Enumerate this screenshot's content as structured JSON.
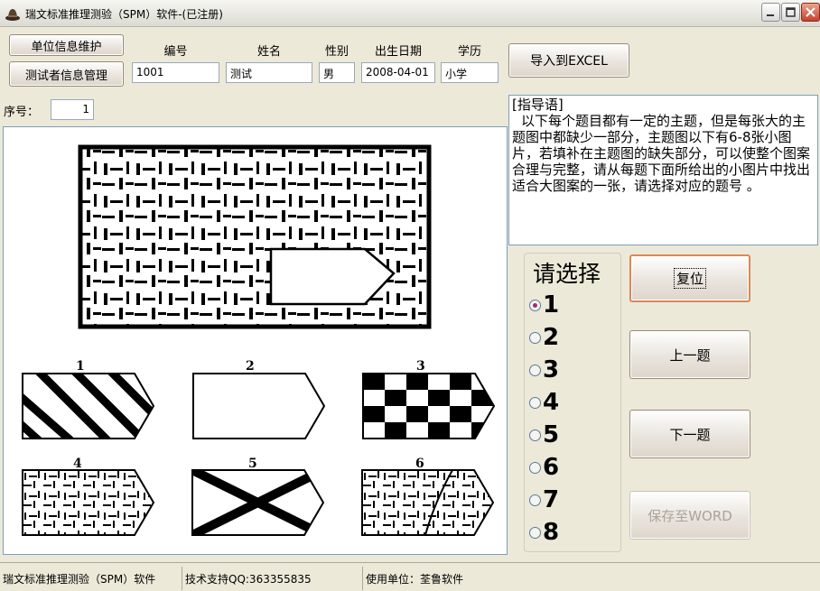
{
  "window": {
    "title": "瑞文标准推理测验（SPM）软件-(已注册)"
  },
  "top_buttons": {
    "unit_info": "单位信息维护",
    "tester_info": "测试者信息管理",
    "export_excel": "导入到EXCEL"
  },
  "fields": {
    "id": {
      "label": "编号",
      "value": "1001"
    },
    "name": {
      "label": "姓名",
      "value": "测试"
    },
    "gender": {
      "label": "性别",
      "value": "男"
    },
    "birth": {
      "label": "出生日期",
      "value": "2008-04-01"
    },
    "education": {
      "label": "学历",
      "value": "小学"
    }
  },
  "sequence": {
    "label": "序号：",
    "value": "1"
  },
  "guide": {
    "heading": "[指导语]",
    "text": "以下每个题目都有一定的主题，但是每张大的主题图中都缺少一部分，主题图以下有6-8张小图片，若填补在主题图的缺失部分，可以使整个图案合理与完整，请从每题下面所给出的小图片中找出适合大图案的一张，请选择对应的题号 。"
  },
  "options_numbers": [
    "1",
    "2",
    "3",
    "4",
    "5",
    "6"
  ],
  "choice": {
    "title": "请选择",
    "options": [
      "1",
      "2",
      "3",
      "4",
      "5",
      "6",
      "7",
      "8"
    ],
    "selected": "1"
  },
  "nav_buttons": {
    "reset": "复位",
    "prev": "上一题",
    "next": "下一题",
    "save_word": "保存至WORD"
  },
  "status": {
    "app": "瑞文标准推理测验（SPM）软件",
    "support": "技术支持QQ:363355835",
    "unit": "使用单位：荃鲁软件"
  }
}
